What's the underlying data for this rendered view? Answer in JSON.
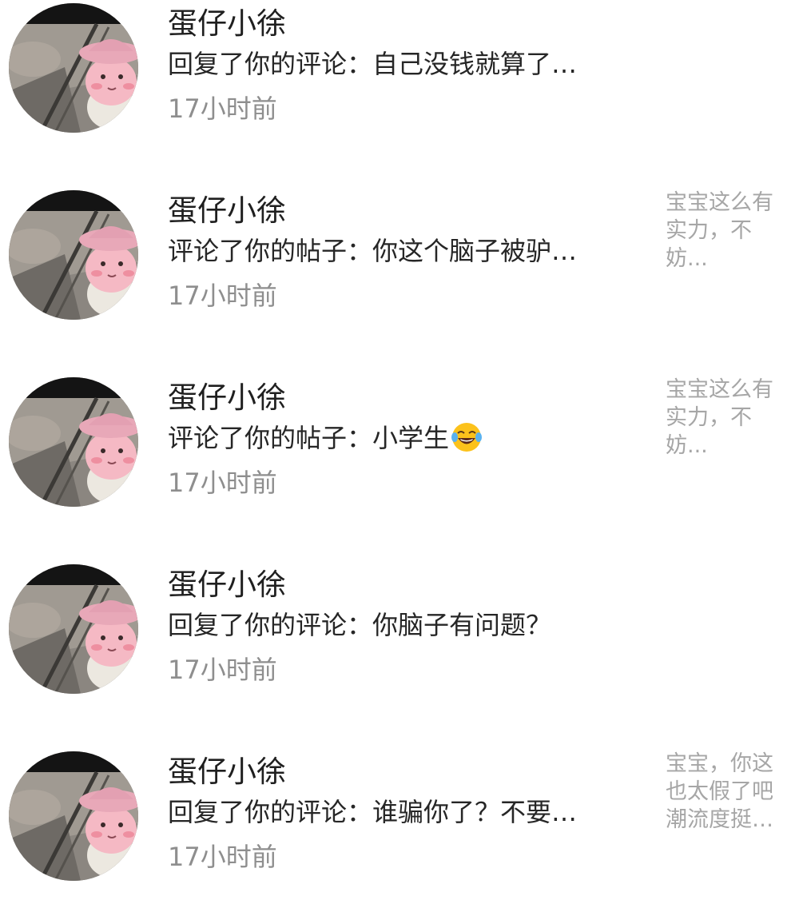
{
  "notifications": [
    {
      "username": "蛋仔小徐",
      "message": "回复了你的评论：自己没钱就算了…",
      "time": "17小时前",
      "preview": "",
      "emoji": ""
    },
    {
      "username": "蛋仔小徐",
      "message": "评论了你的帖子：你这个脑子被驴…",
      "time": "17小时前",
      "preview": "宝宝这么有实力，不妨...",
      "emoji": ""
    },
    {
      "username": "蛋仔小徐",
      "message": "评论了你的帖子：小学生",
      "time": "17小时前",
      "preview": "宝宝这么有实力，不妨...",
      "emoji": "laughing-tears-emoji"
    },
    {
      "username": "蛋仔小徐",
      "message": "回复了你的评论：你脑子有问题？",
      "time": "17小时前",
      "preview": "",
      "emoji": ""
    },
    {
      "username": "蛋仔小徐",
      "message": "回复了你的评论：谁骗你了？不要…",
      "time": "17小时前",
      "preview": "宝宝，你这也太假了吧潮流度挺…",
      "emoji": ""
    }
  ],
  "colors": {
    "username": "#1f1f1f",
    "message": "#262626",
    "time": "#8e8e8e",
    "preview": "#a6a6a6",
    "avatar_hat": "#e8a8b8",
    "avatar_face": "#f5b9c4"
  },
  "icons": {
    "avatar": "pink-plush-lamb-avatar",
    "emoji": "laughing-tears-emoji"
  }
}
